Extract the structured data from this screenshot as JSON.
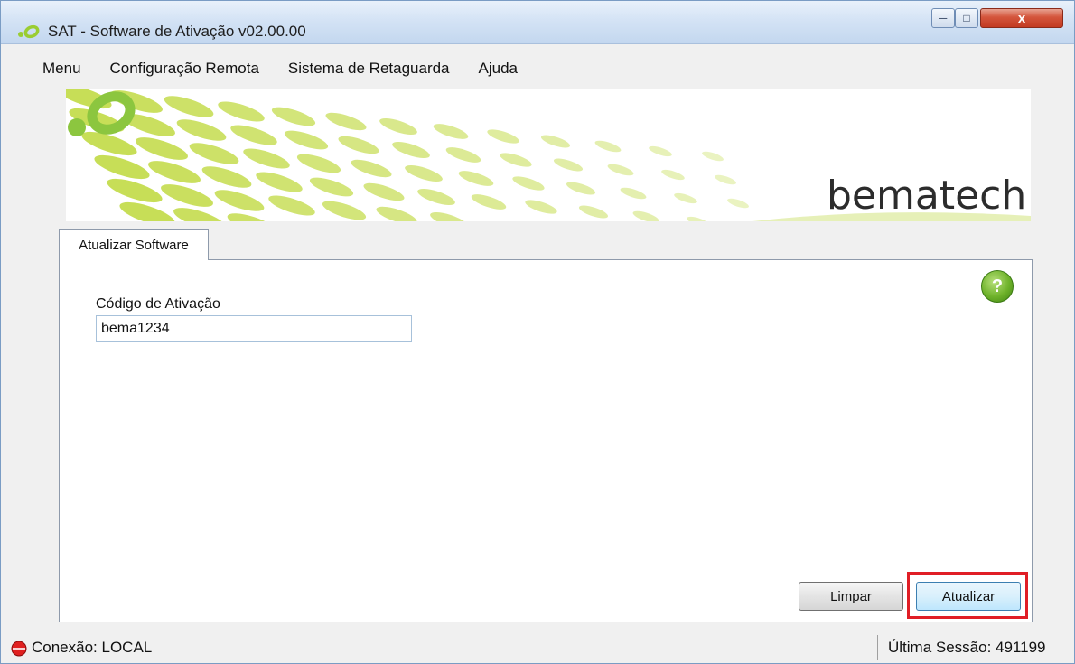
{
  "window": {
    "title": "SAT - Software de Ativação v02.00.00",
    "minimize_icon": "minimize-icon",
    "maximize_icon": "maximize-icon",
    "close_label": "x"
  },
  "menu": {
    "items": [
      {
        "label": "Menu"
      },
      {
        "label": "Configuração Remota"
      },
      {
        "label": "Sistema de Retaguarda"
      },
      {
        "label": "Ajuda"
      }
    ]
  },
  "banner": {
    "brand": "bematech",
    "colors": {
      "green": "#c4dc4e",
      "green_dark": "#7fbf2a"
    }
  },
  "tab": {
    "label": "Atualizar Software",
    "help_label": "?"
  },
  "form": {
    "activation_code_label": "Código de Ativação",
    "activation_code_value": "bema1234"
  },
  "buttons": {
    "clear": "Limpar",
    "update": "Atualizar"
  },
  "status": {
    "connection": "Conexão: LOCAL",
    "last_session": "Última Sessão: 491199",
    "connection_color": "#e02020"
  }
}
